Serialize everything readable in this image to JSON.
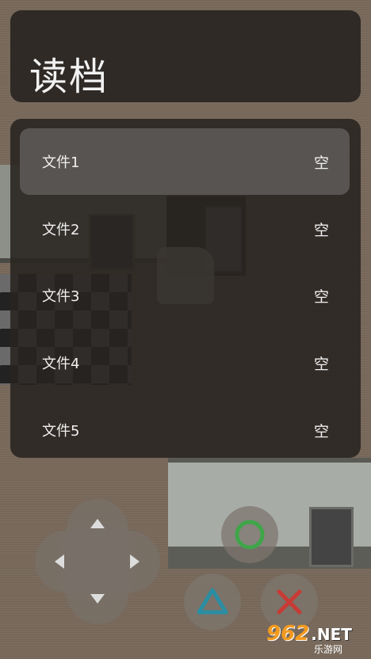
{
  "header": {
    "title": "读档"
  },
  "save_slots": [
    {
      "label": "文件1",
      "status": "空",
      "selected": true
    },
    {
      "label": "文件2",
      "status": "空",
      "selected": false
    },
    {
      "label": "文件3",
      "status": "空",
      "selected": false
    },
    {
      "label": "文件4",
      "status": "空",
      "selected": false
    },
    {
      "label": "文件5",
      "status": "空",
      "selected": false
    }
  ],
  "controls": {
    "dpad": [
      "up",
      "down",
      "left",
      "right"
    ],
    "buttons": [
      {
        "icon": "circle-icon",
        "color": "#3fa54a"
      },
      {
        "icon": "triangle-icon",
        "color": "#2a8ea3"
      },
      {
        "icon": "cross-icon",
        "color": "#c83a34"
      }
    ]
  },
  "watermark": {
    "number": "962",
    "suffix": ".NET",
    "sub": "乐游网"
  }
}
